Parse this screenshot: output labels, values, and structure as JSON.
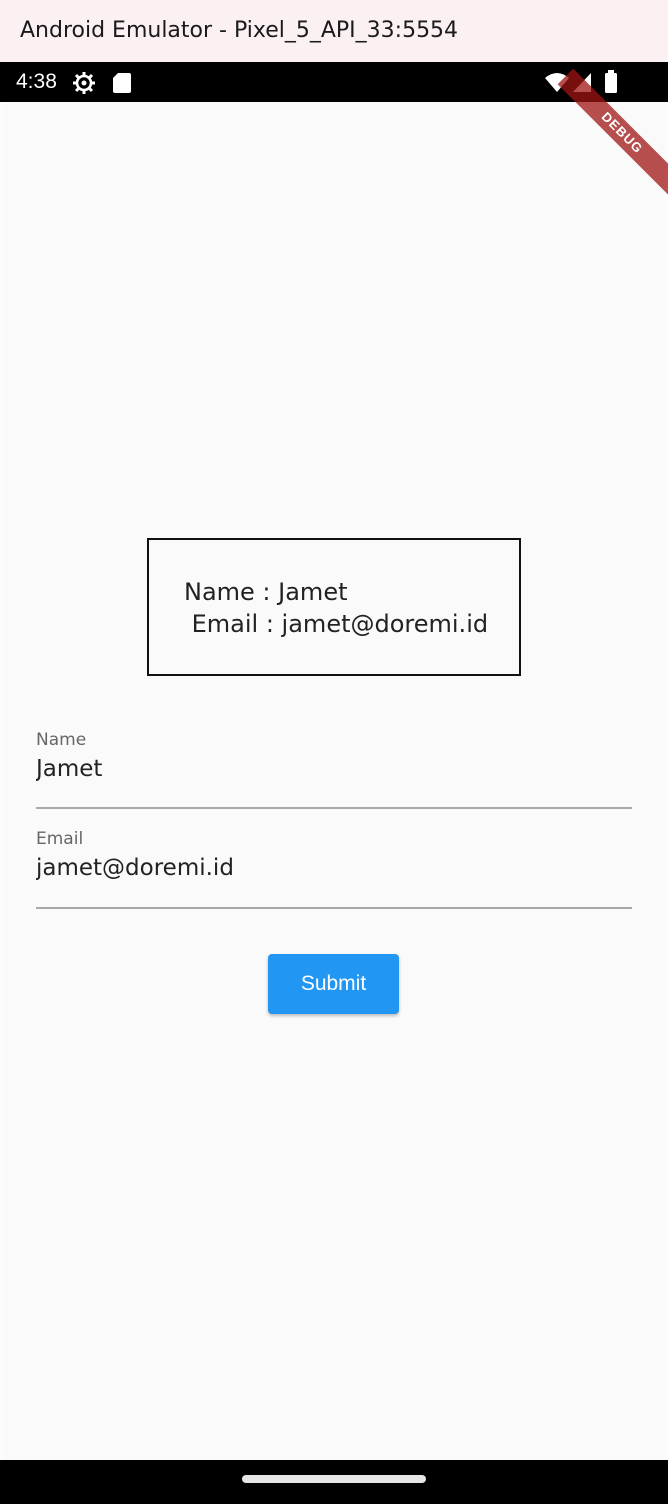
{
  "window": {
    "title": "Android Emulator - Pixel_5_API_33:5554"
  },
  "status_bar": {
    "time": "4:38",
    "icons": [
      "gear-icon",
      "sd-card-icon",
      "wifi-icon",
      "signal-icon",
      "battery-icon"
    ]
  },
  "debug_banner": "DEBUG",
  "info_card": {
    "name_line": "Name : Jamet",
    "email_line": " Email : jamet@doremi.id"
  },
  "form": {
    "name_label": "Name",
    "name_value": "Jamet",
    "email_label": "Email",
    "email_value": "jamet@doremi.id",
    "submit_label": "Submit"
  },
  "colors": {
    "accent": "#2196f3",
    "status_bar": "#000000",
    "title_bar": "#fbf1f3",
    "debug_banner": "#a01414"
  }
}
